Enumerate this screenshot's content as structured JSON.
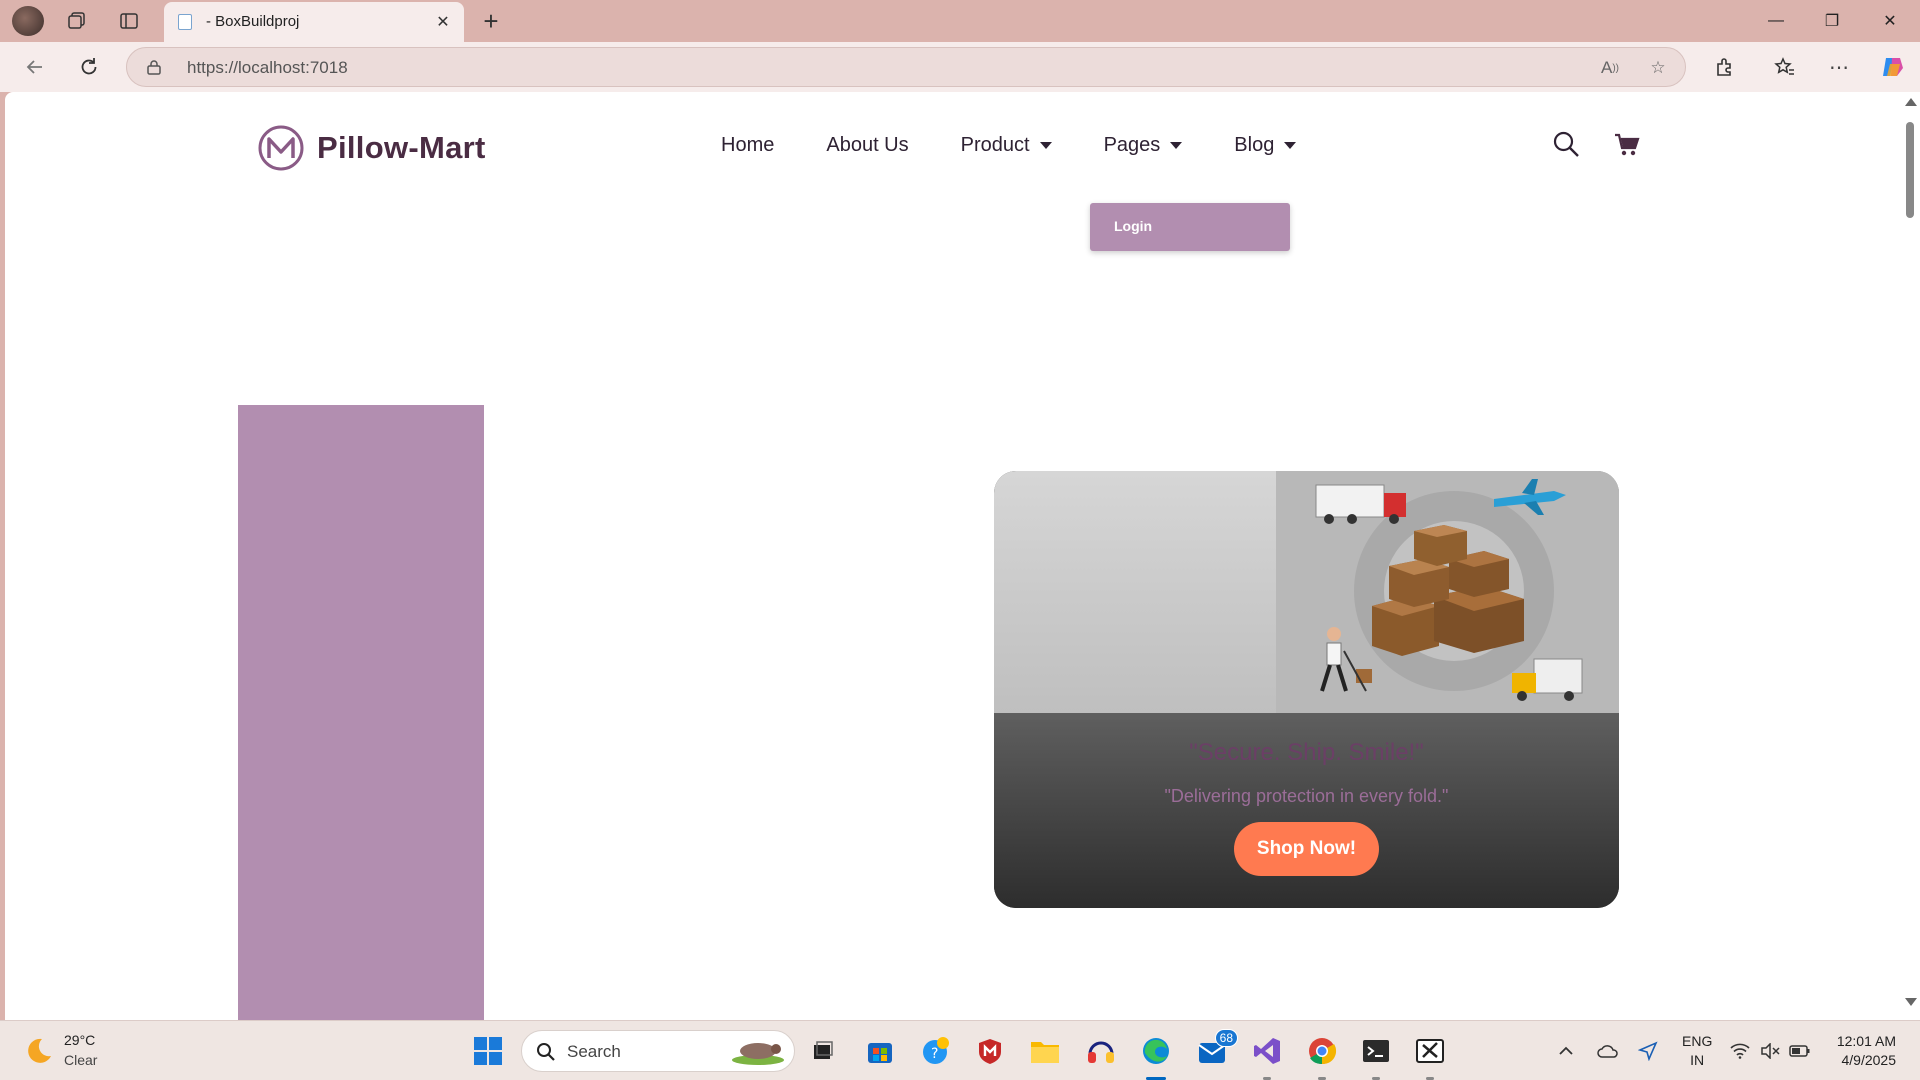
{
  "browser": {
    "tab_title": "- BoxBuildproj",
    "url": "https://localhost:7018",
    "new_tab_symbol": "+",
    "tab_close_symbol": "✕",
    "window_controls": {
      "minimize": "—",
      "restore": "❐",
      "close": "✕"
    }
  },
  "site": {
    "brand": "Pillow-Mart",
    "nav": [
      {
        "label": "Home"
      },
      {
        "label": "About Us"
      },
      {
        "label": "Product"
      },
      {
        "label": "Pages"
      },
      {
        "label": "Blog"
      }
    ],
    "pages_dropdown": {
      "items": [
        "Login"
      ]
    },
    "hero_card": {
      "title": "\"Secure. Ship. Smile!\"",
      "subtitle": "\"Delivering protection in every fold.\"",
      "button": "Shop Now!"
    },
    "colors": {
      "brand_purple": "#b28eb0",
      "brand_text": "#4a2c43",
      "cta_orange": "#ff7a50"
    }
  },
  "taskbar": {
    "weather": {
      "temp": "29°C",
      "desc": "Clear"
    },
    "search_placeholder": "Search",
    "mail_badge": "68",
    "lang_line1": "ENG",
    "lang_line2": "IN",
    "time": "12:01 AM",
    "date": "4/9/2025"
  }
}
